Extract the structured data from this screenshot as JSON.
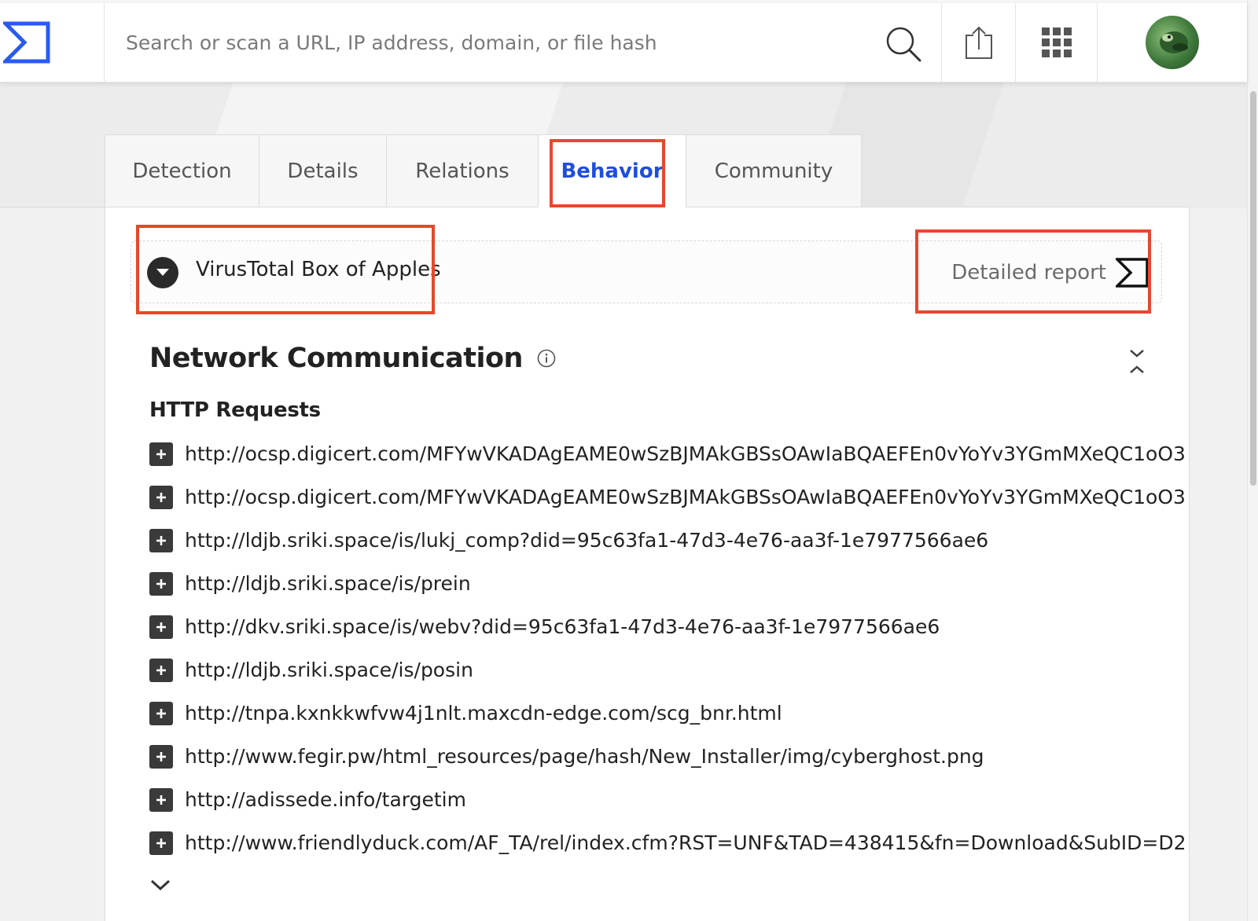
{
  "topbar": {
    "logo_icon": "virustotal-sigma-logo",
    "search_placeholder": "Search or scan a URL, IP address, domain, or file hash",
    "search_icon": "search-icon",
    "upload_icon": "upload-icon",
    "apps_icon": "apps-grid-icon"
  },
  "tabs": [
    {
      "label": "Detection"
    },
    {
      "label": "Details"
    },
    {
      "label": "Relations"
    },
    {
      "label": "Behavior",
      "active": true
    },
    {
      "label": "Community"
    }
  ],
  "sandbox": {
    "name": "VirusTotal Box of Apples",
    "detailed_report_label": "Detailed report"
  },
  "section": {
    "title": "Network Communication",
    "subheading": "HTTP Requests"
  },
  "http_requests": [
    "http://ocsp.digicert.com/MFYwVKADAgEAME0wSzBJMAkGBSsOAwIaBQAEFEn0vYoYv3YGmMXeQC1oO3",
    "http://ocsp.digicert.com/MFYwVKADAgEAME0wSzBJMAkGBSsOAwIaBQAEFEn0vYoYv3YGmMXeQC1oO3",
    "http://ldjb.sriki.space/is/lukj_comp?did=95c63fa1-47d3-4e76-aa3f-1e7977566ae6",
    "http://ldjb.sriki.space/is/prein",
    "http://dkv.sriki.space/is/webv?did=95c63fa1-47d3-4e76-aa3f-1e7977566ae6",
    "http://ldjb.sriki.space/is/posin",
    "http://tnpa.kxnkkwfvw4j1nlt.maxcdn-edge.com/scg_bnr.html",
    "http://www.fegir.pw/html_resources/page/hash/New_Installer/img/cyberghost.png",
    "http://adissede.info/targetim",
    "http://www.friendlyduck.com/AF_TA/rel/index.cfm?RST=UNF&TAD=438415&fn=Download&SubID=D2"
  ],
  "colors": {
    "accent": "#1f4de0",
    "highlight": "#e8472d"
  }
}
